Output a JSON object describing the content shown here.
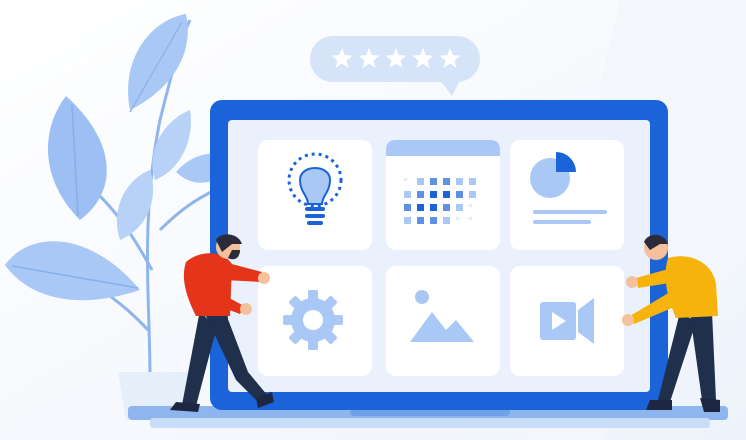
{
  "illustration": {
    "rating": {
      "stars": 5,
      "filled": 5
    },
    "tiles": [
      {
        "icon": "lightbulb-icon"
      },
      {
        "icon": "calendar-icon"
      },
      {
        "icon": "pie-chart-icon"
      },
      {
        "icon": "gear-icon"
      },
      {
        "icon": "image-icon"
      },
      {
        "icon": "video-camera-icon"
      }
    ],
    "colors": {
      "primary": "#1A63D8",
      "accent_light": "#A9C8F5",
      "background": "#F2F6FC",
      "person_left_shirt": "#E4351B",
      "person_right_shirt": "#F5B30B",
      "pants": "#1F2F4C"
    }
  }
}
